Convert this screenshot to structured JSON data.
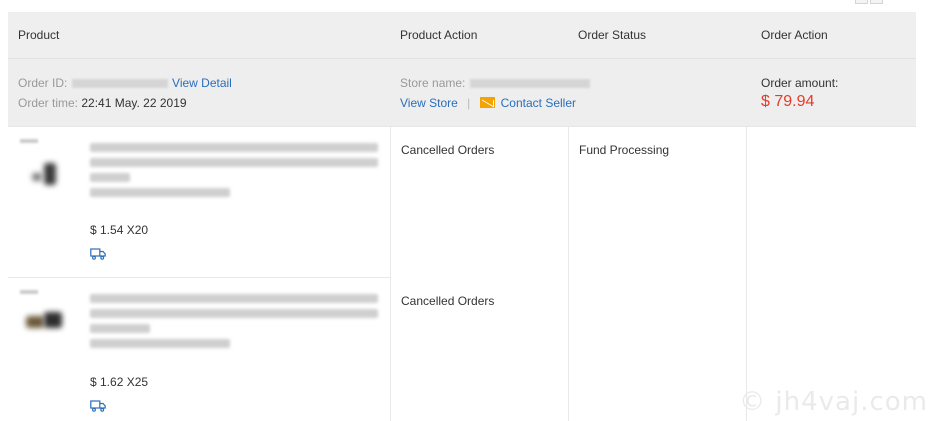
{
  "columns": {
    "product": "Product",
    "product_action": "Product Action",
    "order_status": "Order Status",
    "order_action": "Order Action"
  },
  "order": {
    "order_id_label": "Order ID:",
    "view_detail": "View Detail",
    "order_time_label": "Order time:",
    "order_time": "22:41 May. 22 2019",
    "store_name_label": "Store name:",
    "view_store": "View Store",
    "separator": "|",
    "contact_seller": "Contact Seller",
    "amount_label": "Order amount:",
    "amount": "$ 79.94"
  },
  "items": [
    {
      "price_qty": "$ 1.54 X20",
      "product_action": "Cancelled Orders",
      "status": "Fund Processing"
    },
    {
      "price_qty": "$ 1.62 X25",
      "product_action": "Cancelled Orders"
    }
  ],
  "colors": {
    "header_bg": "#efefef",
    "link": "#2a6ebb",
    "amount": "#e23d2a",
    "mail_icon": "#f4a300"
  },
  "icons": {
    "contact": "mail-icon",
    "shipping": "truck-icon"
  },
  "watermark": "© jh4vaj.com"
}
